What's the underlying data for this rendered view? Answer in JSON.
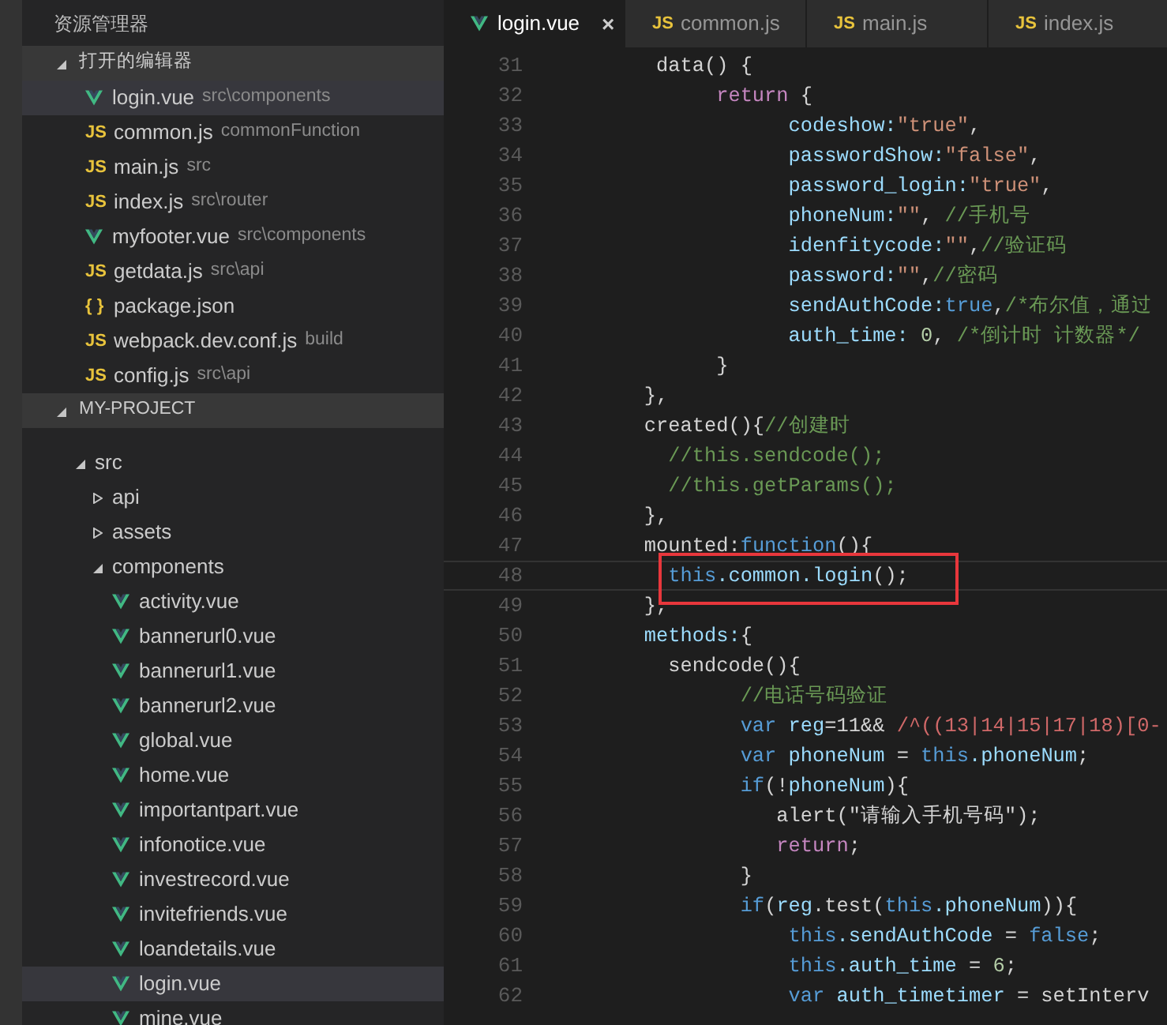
{
  "sidebar": {
    "title": "资源管理器",
    "open_editors": {
      "label": "打开的编辑器",
      "expanded": true,
      "items": [
        {
          "kind": "vue",
          "name": "login.vue",
          "path": "src\\components",
          "selected": true
        },
        {
          "kind": "js",
          "badge": "JS",
          "name": "common.js",
          "path": "commonFunction",
          "selected": false
        },
        {
          "kind": "js",
          "badge": "JS",
          "name": "main.js",
          "path": "src",
          "selected": false
        },
        {
          "kind": "js",
          "badge": "JS",
          "name": "index.js",
          "path": "src\\router",
          "selected": false
        },
        {
          "kind": "vue",
          "name": "myfooter.vue",
          "path": "src\\components",
          "selected": false
        },
        {
          "kind": "js",
          "badge": "JS",
          "name": "getdata.js",
          "path": "src\\api",
          "selected": false
        },
        {
          "kind": "json",
          "badge": "{ }",
          "name": "package.json",
          "selected": false
        },
        {
          "kind": "js",
          "badge": "JS",
          "name": "webpack.dev.conf.js",
          "path": "build",
          "selected": false
        },
        {
          "kind": "js",
          "badge": "JS",
          "name": "config.js",
          "path": "src\\api",
          "selected": false
        }
      ]
    },
    "project": {
      "label": "MY-PROJECT",
      "expanded": true,
      "tree": [
        {
          "kind": "folder",
          "name": "src",
          "expanded": true,
          "selected": false,
          "children": [
            {
              "kind": "folder",
              "name": "api",
              "expanded": false,
              "selected": false
            },
            {
              "kind": "folder",
              "name": "assets",
              "expanded": false,
              "selected": false
            },
            {
              "kind": "folder",
              "name": "components",
              "expanded": true,
              "selected": false,
              "children": [
                {
                  "kind": "vue",
                  "name": "activity.vue",
                  "selected": false
                },
                {
                  "kind": "vue",
                  "name": "bannerurl0.vue",
                  "selected": false
                },
                {
                  "kind": "vue",
                  "name": "bannerurl1.vue",
                  "selected": false
                },
                {
                  "kind": "vue",
                  "name": "bannerurl2.vue",
                  "selected": false
                },
                {
                  "kind": "vue",
                  "name": "global.vue",
                  "selected": false
                },
                {
                  "kind": "vue",
                  "name": "home.vue",
                  "selected": false
                },
                {
                  "kind": "vue",
                  "name": "importantpart.vue",
                  "selected": false
                },
                {
                  "kind": "vue",
                  "name": "infonotice.vue",
                  "selected": false
                },
                {
                  "kind": "vue",
                  "name": "investrecord.vue",
                  "selected": false
                },
                {
                  "kind": "vue",
                  "name": "invitefriends.vue",
                  "selected": false
                },
                {
                  "kind": "vue",
                  "name": "loandetails.vue",
                  "selected": false
                },
                {
                  "kind": "vue",
                  "name": "login.vue",
                  "selected": true
                },
                {
                  "kind": "vue",
                  "name": "mine.vue",
                  "selected": false
                }
              ]
            }
          ]
        }
      ]
    }
  },
  "tabs": [
    {
      "kind": "vue",
      "label": "login.vue",
      "selected": true,
      "close": "×"
    },
    {
      "kind": "js",
      "badge": "JS",
      "label": "common.js",
      "selected": false
    },
    {
      "kind": "js",
      "badge": "JS",
      "label": "main.js",
      "selected": false
    },
    {
      "kind": "js",
      "badge": "JS",
      "label": "index.js",
      "selected": false
    }
  ],
  "editor": {
    "lines": [
      {
        "number": "31",
        "boxed": false,
        "tokens": [
          {
            "kind": "plain",
            "text": "         data() {"
          }
        ]
      },
      {
        "number": "32",
        "boxed": false,
        "tokens": [
          {
            "kind": "keyword",
            "text": "              return"
          },
          {
            "kind": "plain",
            "text": " {"
          }
        ]
      },
      {
        "number": "33",
        "boxed": false,
        "tokens": [
          {
            "kind": "property",
            "text": "                    codeshow:"
          },
          {
            "kind": "string",
            "text": "\"true\""
          },
          {
            "kind": "plain",
            "text": ","
          }
        ]
      },
      {
        "number": "34",
        "boxed": false,
        "tokens": [
          {
            "kind": "property",
            "text": "                    passwordShow:"
          },
          {
            "kind": "string",
            "text": "\"false\""
          },
          {
            "kind": "plain",
            "text": ","
          }
        ]
      },
      {
        "number": "35",
        "boxed": false,
        "tokens": [
          {
            "kind": "property",
            "text": "                    password_login:"
          },
          {
            "kind": "string",
            "text": "\"true\""
          },
          {
            "kind": "plain",
            "text": ","
          }
        ]
      },
      {
        "number": "36",
        "boxed": false,
        "tokens": [
          {
            "kind": "property",
            "text": "                    phoneNum:"
          },
          {
            "kind": "string",
            "text": "\"\""
          },
          {
            "kind": "plain",
            "text": ","
          },
          {
            "kind": "comment",
            "text": " //手机号"
          }
        ]
      },
      {
        "number": "37",
        "boxed": false,
        "tokens": [
          {
            "kind": "property",
            "text": "                    idenfitycode:"
          },
          {
            "kind": "string",
            "text": "\"\""
          },
          {
            "kind": "plain",
            "text": ","
          },
          {
            "kind": "comment",
            "text": "//验证码"
          }
        ]
      },
      {
        "number": "38",
        "boxed": false,
        "tokens": [
          {
            "kind": "property",
            "text": "                    password:"
          },
          {
            "kind": "string",
            "text": "\"\""
          },
          {
            "kind": "plain",
            "text": ","
          },
          {
            "kind": "comment",
            "text": "//密码"
          }
        ]
      },
      {
        "number": "39",
        "boxed": false,
        "tokens": [
          {
            "kind": "property",
            "text": "                    sendAuthCode:"
          },
          {
            "kind": "constant",
            "text": "true"
          },
          {
            "kind": "plain",
            "text": ","
          },
          {
            "kind": "comment",
            "text": "/*布尔值，通过"
          }
        ]
      },
      {
        "number": "40",
        "boxed": false,
        "tokens": [
          {
            "kind": "property",
            "text": "                    auth_time:"
          },
          {
            "kind": "number",
            "text": " 0"
          },
          {
            "kind": "plain",
            "text": ","
          },
          {
            "kind": "comment",
            "text": " /*倒计时 计数器*/"
          }
        ]
      },
      {
        "number": "41",
        "boxed": false,
        "tokens": [
          {
            "kind": "plain",
            "text": "              }"
          }
        ]
      },
      {
        "number": "42",
        "boxed": false,
        "tokens": [
          {
            "kind": "plain",
            "text": "        },"
          }
        ]
      },
      {
        "number": "43",
        "boxed": false,
        "tokens": [
          {
            "kind": "plain",
            "text": "        created(){"
          },
          {
            "kind": "comment",
            "text": "//创建时"
          }
        ]
      },
      {
        "number": "44",
        "boxed": false,
        "tokens": [
          {
            "kind": "comment",
            "text": "          //this.sendcode();"
          }
        ]
      },
      {
        "number": "45",
        "boxed": false,
        "tokens": [
          {
            "kind": "comment",
            "text": "          //this.getParams();"
          }
        ]
      },
      {
        "number": "46",
        "boxed": false,
        "tokens": [
          {
            "kind": "plain",
            "text": "        },"
          }
        ]
      },
      {
        "number": "47",
        "boxed": false,
        "tokens": [
          {
            "kind": "plain",
            "text": "        mounted:"
          },
          {
            "kind": "constant",
            "text": "function"
          },
          {
            "kind": "plain",
            "text": "(){"
          }
        ]
      },
      {
        "number": "48",
        "boxed": true,
        "tokens": [
          {
            "kind": "constant",
            "text": "          this"
          },
          {
            "kind": "property",
            "text": ".common.login"
          },
          {
            "kind": "plain",
            "text": "();"
          }
        ]
      },
      {
        "number": "49",
        "boxed": false,
        "tokens": [
          {
            "kind": "plain",
            "text": "        },"
          }
        ]
      },
      {
        "number": "50",
        "boxed": false,
        "tokens": [
          {
            "kind": "property",
            "text": "        methods:"
          },
          {
            "kind": "plain",
            "text": "{"
          }
        ]
      },
      {
        "number": "51",
        "boxed": false,
        "tokens": [
          {
            "kind": "plain",
            "text": "          sendcode(){"
          }
        ]
      },
      {
        "number": "52",
        "boxed": false,
        "tokens": [
          {
            "kind": "comment",
            "text": "                //电话号码验证"
          }
        ]
      },
      {
        "number": "53",
        "boxed": false,
        "tokens": [
          {
            "kind": "constant",
            "text": "                var"
          },
          {
            "kind": "property",
            "text": " reg"
          },
          {
            "kind": "plain",
            "text": "=11&&"
          },
          {
            "kind": "regex",
            "text": " /^((13|14|15|17|18)[0-"
          }
        ]
      },
      {
        "number": "54",
        "boxed": false,
        "tokens": [
          {
            "kind": "constant",
            "text": "                var"
          },
          {
            "kind": "property",
            "text": " phoneNum"
          },
          {
            "kind": "plain",
            "text": " ="
          },
          {
            "kind": "constant",
            "text": " this"
          },
          {
            "kind": "property",
            "text": ".phoneNum"
          },
          {
            "kind": "plain",
            "text": ";"
          }
        ]
      },
      {
        "number": "55",
        "boxed": false,
        "tokens": [
          {
            "kind": "constant",
            "text": "                if"
          },
          {
            "kind": "plain",
            "text": "(!"
          },
          {
            "kind": "property",
            "text": "phoneNum"
          },
          {
            "kind": "plain",
            "text": "){"
          }
        ]
      },
      {
        "number": "56",
        "boxed": false,
        "tokens": [
          {
            "kind": "plain",
            "text": "                   alert(\"请输入手机号码\");"
          }
        ]
      },
      {
        "number": "57",
        "boxed": false,
        "tokens": [
          {
            "kind": "keyword",
            "text": "                   return"
          },
          {
            "kind": "plain",
            "text": ";"
          }
        ]
      },
      {
        "number": "58",
        "boxed": false,
        "tokens": [
          {
            "kind": "plain",
            "text": "                }"
          }
        ]
      },
      {
        "number": "59",
        "boxed": false,
        "tokens": [
          {
            "kind": "constant",
            "text": "                if"
          },
          {
            "kind": "plain",
            "text": "("
          },
          {
            "kind": "property",
            "text": "reg"
          },
          {
            "kind": "plain",
            "text": ".test("
          },
          {
            "kind": "constant",
            "text": "this"
          },
          {
            "kind": "property",
            "text": ".phoneNum"
          },
          {
            "kind": "plain",
            "text": ")){"
          }
        ]
      },
      {
        "number": "60",
        "boxed": false,
        "tokens": [
          {
            "kind": "constant",
            "text": "                    this"
          },
          {
            "kind": "property",
            "text": ".sendAuthCode"
          },
          {
            "kind": "plain",
            "text": " ="
          },
          {
            "kind": "constant",
            "text": " false"
          },
          {
            "kind": "plain",
            "text": ";"
          }
        ]
      },
      {
        "number": "61",
        "boxed": false,
        "tokens": [
          {
            "kind": "constant",
            "text": "                    this"
          },
          {
            "kind": "property",
            "text": ".auth_time"
          },
          {
            "kind": "plain",
            "text": " ="
          },
          {
            "kind": "number",
            "text": " 6"
          },
          {
            "kind": "plain",
            "text": ";"
          }
        ]
      },
      {
        "number": "62",
        "boxed": false,
        "tokens": [
          {
            "kind": "constant",
            "text": "                    var"
          },
          {
            "kind": "property",
            "text": " auth_timetimer"
          },
          {
            "kind": "plain",
            "text": " = setInterv"
          }
        ]
      }
    ]
  }
}
